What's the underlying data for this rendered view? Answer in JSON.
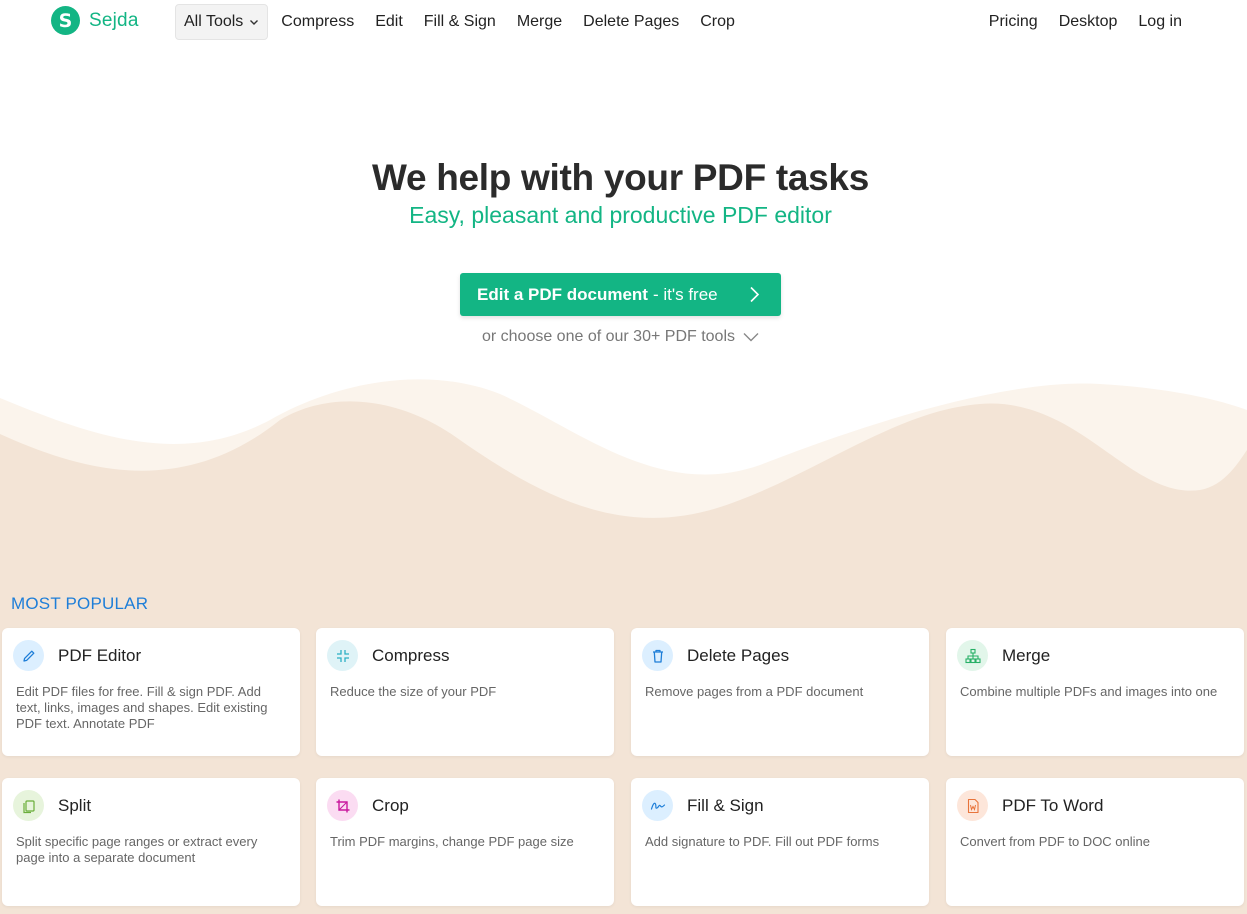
{
  "brand": {
    "logo_letter": "S",
    "name": "Sejda",
    "accent": "#13b584"
  },
  "nav": {
    "all_tools": "All Tools",
    "links": [
      "Compress",
      "Edit",
      "Fill & Sign",
      "Merge",
      "Delete Pages",
      "Crop"
    ],
    "right": [
      "Pricing",
      "Desktop",
      "Log in"
    ]
  },
  "hero": {
    "title": "We help with your PDF tasks",
    "subtitle": "Easy, pleasant and productive PDF editor",
    "cta_strong": "Edit a PDF document",
    "cta_light": "- it's free",
    "choose": "or choose one of our 30+ PDF tools"
  },
  "section": {
    "label": "MOST POPULAR"
  },
  "cards": [
    {
      "title": "PDF Editor",
      "desc": "Edit PDF files for free. Fill & sign PDF. Add text, links, images and shapes. Edit existing PDF text. Annotate PDF",
      "icon": "pencil-icon",
      "icon_bg": "#dcefff",
      "icon_color": "#1e7ed8"
    },
    {
      "title": "Compress",
      "desc": "Reduce the size of your PDF",
      "icon": "compress-icon",
      "icon_bg": "#dff3f7",
      "icon_color": "#2bb0c4"
    },
    {
      "title": "Delete Pages",
      "desc": "Remove pages from a PDF document",
      "icon": "trash-icon",
      "icon_bg": "#dcefff",
      "icon_color": "#1e7ed8"
    },
    {
      "title": "Merge",
      "desc": "Combine multiple PDFs and images into one",
      "icon": "merge-icon",
      "icon_bg": "#e2f6ea",
      "icon_color": "#27b066"
    },
    {
      "title": "Split",
      "desc": "Split specific page ranges or extract every page into a separate document",
      "icon": "split-icon",
      "icon_bg": "#e7f4dc",
      "icon_color": "#6aae3a"
    },
    {
      "title": "Crop",
      "desc": "Trim PDF margins, change PDF page size",
      "icon": "crop-icon",
      "icon_bg": "#fbdcf2",
      "icon_color": "#c9189e"
    },
    {
      "title": "Fill & Sign",
      "desc": "Add signature to PDF. Fill out PDF forms",
      "icon": "signature-icon",
      "icon_bg": "#dcefff",
      "icon_color": "#1e7ed8"
    },
    {
      "title": "PDF To Word",
      "desc": "Convert from PDF to DOC online",
      "icon": "word-doc-icon",
      "icon_bg": "#fde6da",
      "icon_color": "#e8743b"
    }
  ],
  "colors": {
    "beige": "#f3e4d6",
    "cream": "#fbf4ec",
    "link_blue": "#1e7ed8"
  }
}
